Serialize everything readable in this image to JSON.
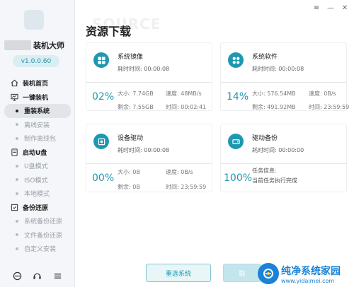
{
  "sidebar": {
    "app_name": "装机大师",
    "version": "v1.0.0.60",
    "sections": [
      {
        "label": "装机首页",
        "icon": "home-icon",
        "children": []
      },
      {
        "label": "一键装机",
        "icon": "monitor-icon",
        "children": [
          {
            "label": "重装系统",
            "active": true
          },
          {
            "label": "离线安装",
            "active": false
          },
          {
            "label": "制作离线包",
            "active": false
          }
        ]
      },
      {
        "label": "启动U盘",
        "icon": "usb-icon",
        "children": [
          {
            "label": "U盘模式",
            "active": false
          },
          {
            "label": "ISO模式",
            "active": false
          },
          {
            "label": "本地模式",
            "active": false
          }
        ]
      },
      {
        "label": "备份还原",
        "icon": "backup-icon",
        "children": [
          {
            "label": "系统备份还原",
            "active": false
          },
          {
            "label": "文件备份还原",
            "active": false
          },
          {
            "label": "自定义安装",
            "active": false
          }
        ]
      }
    ],
    "bottom_icons": [
      "browser-icon",
      "support-icon",
      "menu-icon"
    ]
  },
  "window": {
    "controls": [
      "≡",
      "—",
      "✕"
    ]
  },
  "page": {
    "watermark": "SOURCE",
    "title": "资源下载"
  },
  "cards": [
    {
      "name": "系统镜像",
      "icon": "windows-icon",
      "elapsed_label": "耗时时间:",
      "elapsed": "00:00:08",
      "percent": "02%",
      "size_label": "大小:",
      "size": "7.74GB",
      "speed_label": "速度:",
      "speed": "48MB/s",
      "remain_label": "剩余:",
      "remain": "7.55GB",
      "time_label": "时间:",
      "time": "00:02:41"
    },
    {
      "name": "系统软件",
      "icon": "apps-icon",
      "elapsed_label": "耗时时间:",
      "elapsed": "00:00:08",
      "percent": "14%",
      "size_label": "大小:",
      "size": "576.54MB",
      "speed_label": "速度:",
      "speed": "0B/s",
      "remain_label": "剩余:",
      "remain": "491.92MB",
      "time_label": "时间:",
      "time": "23:59:59"
    },
    {
      "name": "设备驱动",
      "icon": "driver-icon",
      "elapsed_label": "耗时时间:",
      "elapsed": "00:00:08",
      "percent": "00%",
      "size_label": "大小:",
      "size": "0B",
      "speed_label": "速度:",
      "speed": "0B/s",
      "remain_label": "剩余:",
      "remain": "0B",
      "time_label": "时间:",
      "time": "23:59:59"
    },
    {
      "name": "驱动备份",
      "icon": "drive-backup-icon",
      "elapsed_label": "耗时时间:",
      "elapsed": "00:00:00",
      "percent": "100%",
      "task_label": "任务信息:",
      "task_value": "当前任务执行完成"
    }
  ],
  "buttons": {
    "reselect": "重选系统",
    "cancel": "取"
  },
  "brand": {
    "name": "纯净系统家园",
    "url": "www.yidaimei.com"
  },
  "colors": {
    "accent": "#1e98b0",
    "brand": "#1a82d8"
  }
}
